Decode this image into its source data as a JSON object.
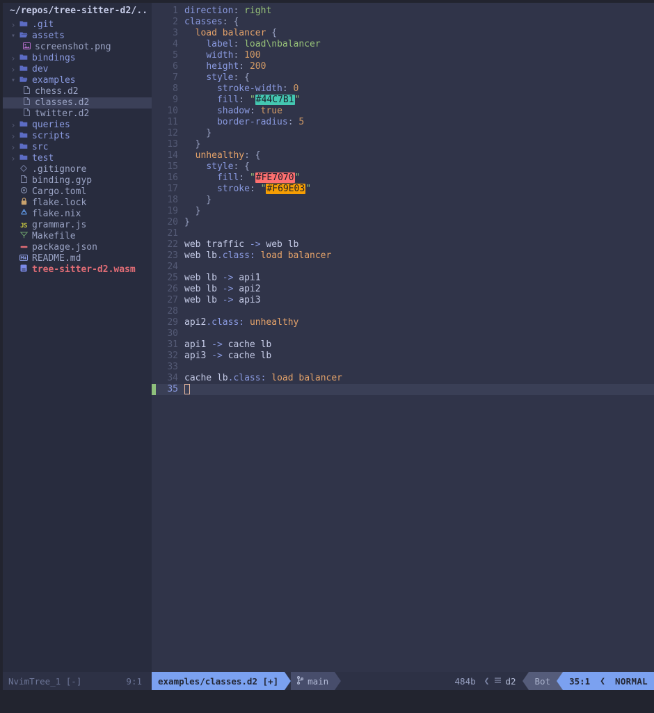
{
  "sidebar": {
    "title": "~/repos/tree-sitter-d2/..",
    "items": [
      {
        "label": ".git",
        "kind": "dir",
        "state": "closed",
        "indent": 1,
        "icon": "folder-icon",
        "color": "c-dir"
      },
      {
        "label": "assets",
        "kind": "dir",
        "state": "open",
        "indent": 1,
        "icon": "folder-open-icon",
        "color": "c-dir"
      },
      {
        "label": "screenshot.png",
        "kind": "file",
        "state": "",
        "indent": 2,
        "icon": "image-file-icon",
        "color": "c-file"
      },
      {
        "label": "bindings",
        "kind": "dir",
        "state": "closed",
        "indent": 1,
        "icon": "folder-icon",
        "color": "c-dir"
      },
      {
        "label": "dev",
        "kind": "dir",
        "state": "closed",
        "indent": 1,
        "icon": "folder-icon",
        "color": "c-dir"
      },
      {
        "label": "examples",
        "kind": "dir",
        "state": "open",
        "indent": 1,
        "icon": "folder-open-icon",
        "color": "c-dir"
      },
      {
        "label": "chess.d2",
        "kind": "file",
        "state": "",
        "indent": 2,
        "icon": "file-icon",
        "color": "c-file"
      },
      {
        "label": "classes.d2",
        "kind": "file",
        "state": "",
        "indent": 2,
        "icon": "file-icon",
        "color": "c-file",
        "selected": true
      },
      {
        "label": "twitter.d2",
        "kind": "file",
        "state": "",
        "indent": 2,
        "icon": "file-icon",
        "color": "c-file"
      },
      {
        "label": "queries",
        "kind": "dir",
        "state": "closed",
        "indent": 1,
        "icon": "folder-icon",
        "color": "c-dir"
      },
      {
        "label": "scripts",
        "kind": "dir",
        "state": "closed",
        "indent": 1,
        "icon": "folder-icon",
        "color": "c-dir"
      },
      {
        "label": "src",
        "kind": "dir",
        "state": "closed",
        "indent": 1,
        "icon": "folder-icon",
        "color": "c-dir"
      },
      {
        "label": "test",
        "kind": "dir",
        "state": "closed",
        "indent": 1,
        "icon": "folder-icon",
        "color": "c-dir"
      },
      {
        "label": ".gitignore",
        "kind": "file",
        "state": "",
        "indent": 1,
        "icon": "git-icon",
        "color": "c-file"
      },
      {
        "label": "binding.gyp",
        "kind": "file",
        "state": "",
        "indent": 1,
        "icon": "file-icon",
        "color": "c-file"
      },
      {
        "label": "Cargo.toml",
        "kind": "file",
        "state": "",
        "indent": 1,
        "icon": "gear-icon",
        "color": "c-file"
      },
      {
        "label": "flake.lock",
        "kind": "file",
        "state": "",
        "indent": 1,
        "icon": "lock-icon",
        "color": "c-file"
      },
      {
        "label": "flake.nix",
        "kind": "file",
        "state": "",
        "indent": 1,
        "icon": "nix-icon",
        "color": "c-file"
      },
      {
        "label": "grammar.js",
        "kind": "file",
        "state": "",
        "indent": 1,
        "icon": "javascript-icon",
        "color": "c-file"
      },
      {
        "label": "Makefile",
        "kind": "file",
        "state": "",
        "indent": 1,
        "icon": "makefile-icon",
        "color": "c-file"
      },
      {
        "label": "package.json",
        "kind": "file",
        "state": "",
        "indent": 1,
        "icon": "json-icon",
        "color": "c-file"
      },
      {
        "label": "README.md",
        "kind": "file",
        "state": "",
        "indent": 1,
        "icon": "markdown-icon",
        "color": "c-file"
      },
      {
        "label": "tree-sitter-d2.wasm",
        "kind": "file",
        "state": "",
        "indent": 1,
        "icon": "wasm-icon",
        "color": "c-wasm"
      }
    ]
  },
  "editor": {
    "cursor_line": 35,
    "lines": [
      {
        "n": 1,
        "tokens": [
          {
            "t": "direction",
            "c": "t-key"
          },
          {
            "t": ": ",
            "c": "t-punc"
          },
          {
            "t": "right",
            "c": "t-str"
          }
        ]
      },
      {
        "n": 2,
        "tokens": [
          {
            "t": "classes",
            "c": "t-key"
          },
          {
            "t": ": {",
            "c": "t-punc"
          }
        ]
      },
      {
        "n": 3,
        "tokens": [
          {
            "t": "  ",
            "c": "t-punc"
          },
          {
            "t": "load balancer",
            "c": "t-cls"
          },
          {
            "t": " {",
            "c": "t-punc"
          }
        ]
      },
      {
        "n": 4,
        "tokens": [
          {
            "t": "    ",
            "c": "t-punc"
          },
          {
            "t": "label",
            "c": "t-key"
          },
          {
            "t": ": ",
            "c": "t-punc"
          },
          {
            "t": "load\\nbalancer",
            "c": "t-str"
          }
        ]
      },
      {
        "n": 5,
        "tokens": [
          {
            "t": "    ",
            "c": "t-punc"
          },
          {
            "t": "width",
            "c": "t-key"
          },
          {
            "t": ": ",
            "c": "t-punc"
          },
          {
            "t": "100",
            "c": "t-num"
          }
        ]
      },
      {
        "n": 6,
        "tokens": [
          {
            "t": "    ",
            "c": "t-punc"
          },
          {
            "t": "height",
            "c": "t-key"
          },
          {
            "t": ": ",
            "c": "t-punc"
          },
          {
            "t": "200",
            "c": "t-num"
          }
        ]
      },
      {
        "n": 7,
        "tokens": [
          {
            "t": "    ",
            "c": "t-punc"
          },
          {
            "t": "style",
            "c": "t-key"
          },
          {
            "t": ": {",
            "c": "t-punc"
          }
        ]
      },
      {
        "n": 8,
        "tokens": [
          {
            "t": "      ",
            "c": "t-punc"
          },
          {
            "t": "stroke-width",
            "c": "t-key"
          },
          {
            "t": ": ",
            "c": "t-punc"
          },
          {
            "t": "0",
            "c": "t-num"
          }
        ]
      },
      {
        "n": 9,
        "tokens": [
          {
            "t": "      ",
            "c": "t-punc"
          },
          {
            "t": "fill",
            "c": "t-key"
          },
          {
            "t": ": ",
            "c": "t-punc"
          },
          {
            "t": "\"",
            "c": "t-quote"
          },
          {
            "t": "#44C7B1",
            "c": "sw",
            "bg": "#44C7B1"
          },
          {
            "t": "\"",
            "c": "t-quote"
          }
        ]
      },
      {
        "n": 10,
        "tokens": [
          {
            "t": "      ",
            "c": "t-punc"
          },
          {
            "t": "shadow",
            "c": "t-key"
          },
          {
            "t": ": ",
            "c": "t-punc"
          },
          {
            "t": "true",
            "c": "t-bool"
          }
        ]
      },
      {
        "n": 11,
        "tokens": [
          {
            "t": "      ",
            "c": "t-punc"
          },
          {
            "t": "border-radius",
            "c": "t-key"
          },
          {
            "t": ": ",
            "c": "t-punc"
          },
          {
            "t": "5",
            "c": "t-num"
          }
        ]
      },
      {
        "n": 12,
        "tokens": [
          {
            "t": "    }",
            "c": "t-punc"
          }
        ]
      },
      {
        "n": 13,
        "tokens": [
          {
            "t": "  }",
            "c": "t-punc"
          }
        ]
      },
      {
        "n": 14,
        "tokens": [
          {
            "t": "  ",
            "c": "t-punc"
          },
          {
            "t": "unhealthy",
            "c": "t-cls"
          },
          {
            "t": ": {",
            "c": "t-punc"
          }
        ]
      },
      {
        "n": 15,
        "tokens": [
          {
            "t": "    ",
            "c": "t-punc"
          },
          {
            "t": "style",
            "c": "t-key"
          },
          {
            "t": ": {",
            "c": "t-punc"
          }
        ]
      },
      {
        "n": 16,
        "tokens": [
          {
            "t": "      ",
            "c": "t-punc"
          },
          {
            "t": "fill",
            "c": "t-key"
          },
          {
            "t": ": ",
            "c": "t-punc"
          },
          {
            "t": "\"",
            "c": "t-quote"
          },
          {
            "t": "#FE7070",
            "c": "sw",
            "bg": "#FE7070"
          },
          {
            "t": "\"",
            "c": "t-quote"
          }
        ]
      },
      {
        "n": 17,
        "tokens": [
          {
            "t": "      ",
            "c": "t-punc"
          },
          {
            "t": "stroke",
            "c": "t-key"
          },
          {
            "t": ": ",
            "c": "t-punc"
          },
          {
            "t": "\"",
            "c": "t-quote"
          },
          {
            "t": "#F69E03",
            "c": "sw",
            "bg": "#F69E03"
          },
          {
            "t": "\"",
            "c": "t-quote"
          }
        ]
      },
      {
        "n": 18,
        "tokens": [
          {
            "t": "    }",
            "c": "t-punc"
          }
        ]
      },
      {
        "n": 19,
        "tokens": [
          {
            "t": "  }",
            "c": "t-punc"
          }
        ]
      },
      {
        "n": 20,
        "tokens": [
          {
            "t": "}",
            "c": "t-punc"
          }
        ]
      },
      {
        "n": 21,
        "tokens": []
      },
      {
        "n": 22,
        "tokens": [
          {
            "t": "web traffic",
            "c": "t-plain"
          },
          {
            "t": " -> ",
            "c": "t-arrow"
          },
          {
            "t": "web lb",
            "c": "t-plain"
          }
        ]
      },
      {
        "n": 23,
        "tokens": [
          {
            "t": "web lb",
            "c": "t-plain"
          },
          {
            "t": ".class: ",
            "c": "t-key"
          },
          {
            "t": "load balancer",
            "c": "t-cls"
          }
        ]
      },
      {
        "n": 24,
        "tokens": []
      },
      {
        "n": 25,
        "tokens": [
          {
            "t": "web lb",
            "c": "t-plain"
          },
          {
            "t": " -> ",
            "c": "t-arrow"
          },
          {
            "t": "api1",
            "c": "t-plain"
          }
        ]
      },
      {
        "n": 26,
        "tokens": [
          {
            "t": "web lb",
            "c": "t-plain"
          },
          {
            "t": " -> ",
            "c": "t-arrow"
          },
          {
            "t": "api2",
            "c": "t-plain"
          }
        ]
      },
      {
        "n": 27,
        "tokens": [
          {
            "t": "web lb",
            "c": "t-plain"
          },
          {
            "t": " -> ",
            "c": "t-arrow"
          },
          {
            "t": "api3",
            "c": "t-plain"
          }
        ]
      },
      {
        "n": 28,
        "tokens": []
      },
      {
        "n": 29,
        "tokens": [
          {
            "t": "api2",
            "c": "t-plain"
          },
          {
            "t": ".class: ",
            "c": "t-key"
          },
          {
            "t": "unhealthy",
            "c": "t-cls"
          }
        ]
      },
      {
        "n": 30,
        "tokens": []
      },
      {
        "n": 31,
        "tokens": [
          {
            "t": "api1",
            "c": "t-plain"
          },
          {
            "t": " -> ",
            "c": "t-arrow"
          },
          {
            "t": "cache lb",
            "c": "t-plain"
          }
        ]
      },
      {
        "n": 32,
        "tokens": [
          {
            "t": "api3",
            "c": "t-plain"
          },
          {
            "t": " -> ",
            "c": "t-arrow"
          },
          {
            "t": "cache lb",
            "c": "t-plain"
          }
        ]
      },
      {
        "n": 33,
        "tokens": []
      },
      {
        "n": 34,
        "tokens": [
          {
            "t": "cache lb",
            "c": "t-plain"
          },
          {
            "t": ".class: ",
            "c": "t-key"
          },
          {
            "t": "load balancer",
            "c": "t-cls"
          }
        ]
      },
      {
        "n": 35,
        "tokens": [],
        "cursor": true
      }
    ]
  },
  "statusline": {
    "tree_label": "NvimTree_1 [-]",
    "tree_pos": "9:1",
    "file": "examples/classes.d2 [+]",
    "branch": "main",
    "filesize": "484b",
    "filetype": "d2",
    "scroll": "Bot",
    "position": "35:1",
    "mode": "NORMAL"
  },
  "colors": {
    "bg_outer": "#22242f",
    "bg_sidebar": "#282c3e",
    "bg_editor": "#303449",
    "bg_cursorline": "#3a3f56",
    "bg_selected_row": "#3b4058",
    "accent_blue": "#7ba1f0",
    "segment_grey": "#555c7a",
    "swatch_teal": "#44C7B1",
    "swatch_red": "#FE7070",
    "swatch_orange": "#F69E03",
    "sign_green": "#8ec07c"
  }
}
